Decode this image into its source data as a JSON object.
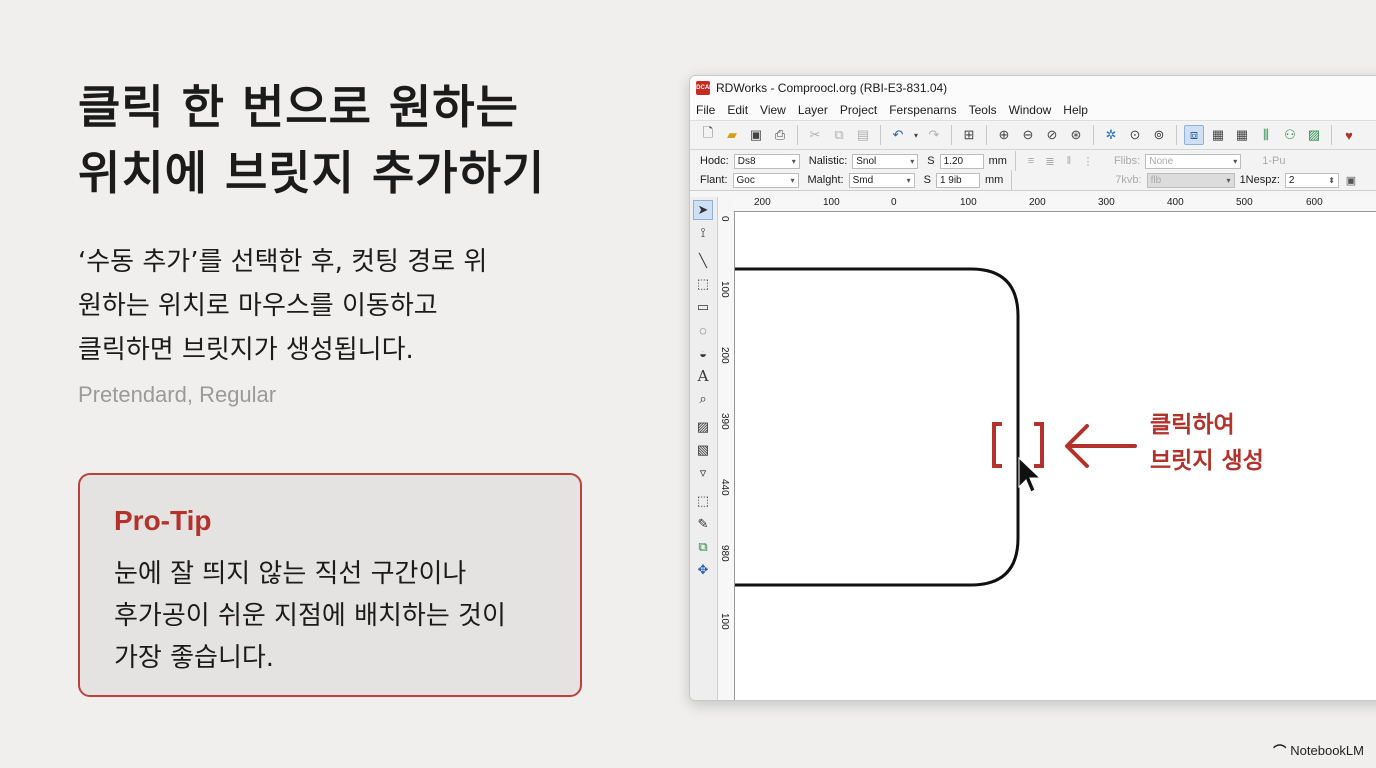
{
  "slide": {
    "title_line1": "클릭 한 번으로 원하는",
    "title_line2": "위치에 브릿지 추가하기",
    "desc_line1": "‘수동 추가’를 선택한 후, 컷팅 경로 위",
    "desc_line2": "원하는 위치로 마우스를 이동하고",
    "desc_line3": "클릭하면 브릿지가 생성됩니다.",
    "font_note": "Pretendard, Regular",
    "tip_title": "Pro-Tip",
    "tip_line1": "눈에 잘 띄지 않는 직선 구간이나",
    "tip_line2": "후가공이 쉬운 지점에 배치하는 것이",
    "tip_line3": "가장 좋습니다.",
    "annotation_line1": "클릭하여",
    "annotation_line2": "브릿지 생성",
    "brand": "NotebookLM"
  },
  "app": {
    "logo_text": "RDCAM",
    "title": "RDWorks - Comproocl.org (RBI-E3-831.04)",
    "menu": [
      "File",
      "Edit",
      "View",
      "Layer",
      "Project",
      "Ferspenarns",
      "Teols",
      "Window",
      "Help"
    ],
    "props": {
      "hodc_label": "Hodc:",
      "hodc_value": "Ds8",
      "nalistic_label": "Nalistic:",
      "nalistic_value": "Snol",
      "s1_label": "S",
      "s1_value": "1.20",
      "s1_unit": "mm",
      "flant_label": "Flant:",
      "flant_value": "Goc",
      "malght_label": "Malght:",
      "malght_value": "Smd",
      "s2_label": "S",
      "s2_value": "1 9ib",
      "s2_unit": "mm",
      "flibs_label": "Flibs:",
      "flibs_value": "None",
      "tkvb_label": "7kvb:",
      "tkvb_value": "flb",
      "nespz_label": "1Nespz:",
      "nespz_value": "2",
      "right_label": "1-Pu"
    },
    "hruler": [
      "200",
      "100",
      "0",
      "100",
      "200",
      "300",
      "400",
      "500",
      "600"
    ],
    "vruler": [
      "0",
      "100",
      "200",
      "390",
      "440",
      "980",
      "100"
    ]
  },
  "colors": {
    "accent": "#b3322b",
    "background": "#f0efed",
    "tip_bg": "#e4e3e1"
  }
}
